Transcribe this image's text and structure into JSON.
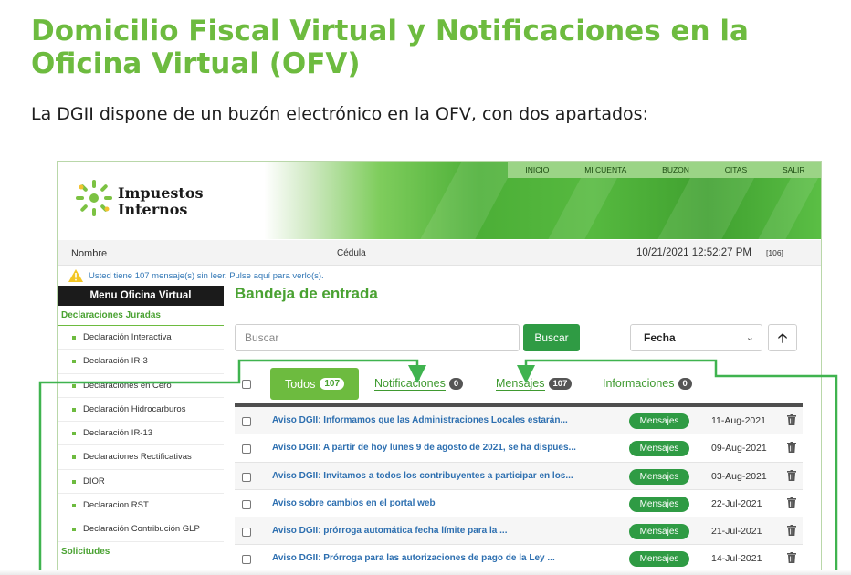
{
  "slide": {
    "title": "Domicilio Fiscal Virtual y Notificaciones en la Oficina Virtual (OFV)",
    "subtitle": "La DGII dispone de un buzón electrónico en la OFV, con dos apartados:"
  },
  "header": {
    "logo_line1": "Impuestos",
    "logo_line2": "Internos",
    "nav": [
      "INICIO",
      "MI CUENTA",
      "BUZON",
      "CITAS",
      "SALIR"
    ]
  },
  "info": {
    "name_label": "Nombre",
    "id_label": "Cédula",
    "datetime": "10/21/2021 12:52:27 PM",
    "counter": "[106]"
  },
  "alert": {
    "text": "Usted tiene 107 mensaje(s) sin leer. Pulse aquí para verlo(s)."
  },
  "sidebar": {
    "menu_title": "Menu Oficina Virtual",
    "section1": "Declaraciones Juradas",
    "items": [
      "Declaración Interactiva",
      "Declaración IR-3",
      "Declaraciones en Cero",
      "Declaración Hidrocarburos",
      "Declaración IR-13",
      "Declaraciones Rectificativas",
      "DIOR",
      "Declaracion RST",
      "Declaración Contribución GLP"
    ],
    "section2": "Solicitudes"
  },
  "inbox": {
    "title": "Bandeja de entrada",
    "search_placeholder": "Buscar",
    "search_button": "Buscar",
    "sort_value": "Fecha",
    "tabs": [
      {
        "label": "Todos",
        "count": "107"
      },
      {
        "label": "Notificaciones",
        "count": "0"
      },
      {
        "label": "Mensajes",
        "count": "107"
      },
      {
        "label": "Informaciones",
        "count": "0"
      }
    ],
    "rows": [
      {
        "subject": "Aviso DGII: Informamos que las Administraciones Locales estarán...",
        "tag": "Mensajes",
        "date": "11-Aug-2021"
      },
      {
        "subject": "Aviso DGII: A partir de hoy lunes 9 de agosto de 2021, se ha dispues...",
        "tag": "Mensajes",
        "date": "09-Aug-2021"
      },
      {
        "subject": "Aviso DGII: Invitamos a todos los contribuyentes a participar en los...",
        "tag": "Mensajes",
        "date": "03-Aug-2021"
      },
      {
        "subject": "Aviso sobre cambios en el portal web",
        "tag": "Mensajes",
        "date": "22-Jul-2021"
      },
      {
        "subject": "Aviso DGII: prórroga automática fecha límite para la ...",
        "tag": "Mensajes",
        "date": "21-Jul-2021"
      },
      {
        "subject": "Aviso DGII: Prórroga para las autorizaciones de pago de la Ley ...",
        "tag": "Mensajes",
        "date": "14-Jul-2021"
      }
    ]
  },
  "colors": {
    "accent": "#6dbb3f",
    "button": "#2f9b44",
    "link": "#2d6fb0"
  }
}
